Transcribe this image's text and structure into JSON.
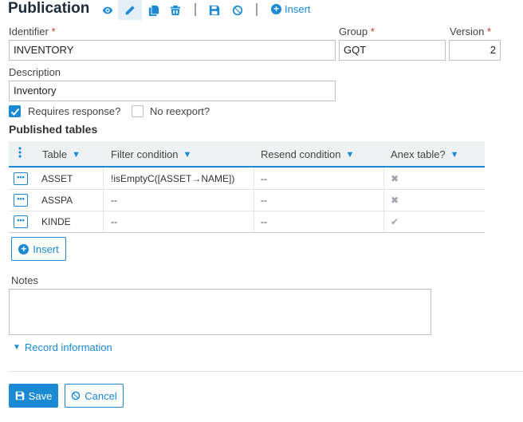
{
  "header": {
    "title": "Publication",
    "insert_label": "Insert",
    "icons": [
      "eye-icon",
      "pencil-icon",
      "copy-icon",
      "trash-icon",
      "save-icon",
      "ban-icon",
      "plus-circle-icon"
    ]
  },
  "form": {
    "identifier_label": "Identifier",
    "identifier_value": "INVENTORY",
    "group_label": "Group",
    "group_value": "GQT",
    "version_label": "Version",
    "version_value": "2",
    "description_label": "Description",
    "description_value": "Inventory",
    "required_mark": "*",
    "requires_response_label": "Requires response?",
    "requires_response_checked": true,
    "no_reexport_label": "No reexport?",
    "no_reexport_checked": false
  },
  "tables": {
    "title": "Published tables",
    "columns": [
      "Table",
      "Filter condition",
      "Resend condition",
      "Anex table?"
    ],
    "rows": [
      {
        "table": "ASSET",
        "filter": "!isEmptyC([ASSET→NAME])",
        "resend": "--",
        "anex": "✖"
      },
      {
        "table": "ASSPA",
        "filter": "--",
        "resend": "--",
        "anex": "✖"
      },
      {
        "table": "KINDE",
        "filter": "--",
        "resend": "--",
        "anex": "✔"
      }
    ],
    "insert_label": "Insert",
    "row_button_label": "•••"
  },
  "notes": {
    "label": "Notes",
    "value": ""
  },
  "record_info_label": "Record information",
  "footer": {
    "save_label": "Save",
    "cancel_label": "Cancel"
  },
  "colors": {
    "accent": "#1a8ad4",
    "required": "#d0312d"
  }
}
